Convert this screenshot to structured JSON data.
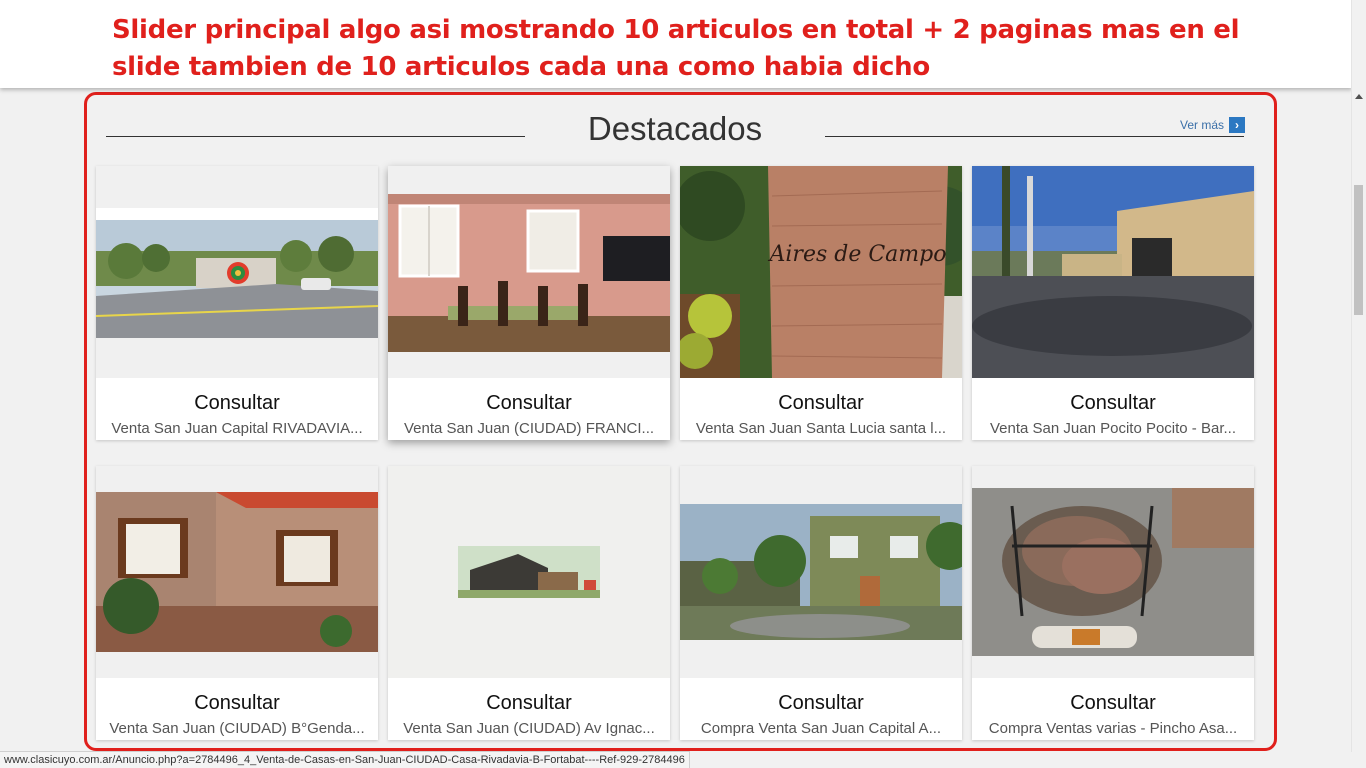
{
  "annotation": {
    "text": "Slider principal algo asi mostrando 10 articulos en total + 2 paginas mas en el slide tambien de 10 articulos cada una como habia dicho",
    "color": "#e0201c"
  },
  "section": {
    "title": "Destacados",
    "ver_mas": "Ver más"
  },
  "cards": [
    {
      "price": "Consultar",
      "desc": "Venta San Juan Capital RIVADAVIA...",
      "image": "street-corner-photo"
    },
    {
      "price": "Consultar",
      "desc": "Venta San Juan (CIUDAD) FRANCI...",
      "image": "dining-room-photo"
    },
    {
      "price": "Consultar",
      "desc": "Venta San Juan Santa Lucia santa l...",
      "image": "stone-sign-photo",
      "sign_text": "Aires de Campo"
    },
    {
      "price": "Consultar",
      "desc": "Venta San Juan Pocito Pocito - Bar...",
      "image": "gated-entrance-photo"
    },
    {
      "price": "Consultar",
      "desc": "Venta San Juan (CIUDAD) B°Genda...",
      "image": "brick-house-photo"
    },
    {
      "price": "Consultar",
      "desc": "Venta San Juan (CIUDAD) Av Ignac...",
      "image": "house-render-thumbnail"
    },
    {
      "price": "Consultar",
      "desc": "Compra Venta San Juan Capital A...",
      "image": "duplex-render-photo"
    },
    {
      "price": "Consultar",
      "desc": "Compra Ventas varias - Pincho Asa...",
      "image": "grill-skewer-photo"
    }
  ],
  "status_bar": {
    "url": "www.clasicuyo.com.ar/Anuncio.php?a=2784496_4_Venta-de-Casas-en-San-Juan-CIUDAD-Casa-Rivadavia-B-Fortabat----Ref-929-2784496"
  },
  "colors": {
    "accent_blue": "#2b78c2",
    "annotation_red": "#e0201c"
  }
}
